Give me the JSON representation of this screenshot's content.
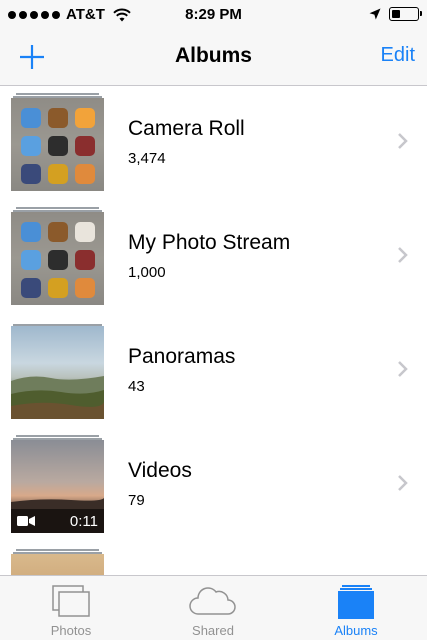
{
  "status_bar": {
    "carrier": "AT&T",
    "time": "8:29 PM",
    "icons": [
      "signal-dots-icon",
      "wifi-icon",
      "location-arrow-icon",
      "battery-icon"
    ]
  },
  "navbar": {
    "add_icon": "plus-icon",
    "title": "Albums",
    "edit_label": "Edit"
  },
  "albums": [
    {
      "name": "Camera Roll",
      "count": "3,474",
      "thumbnail": "home-screen-photo"
    },
    {
      "name": "My Photo Stream",
      "count": "1,000",
      "thumbnail": "home-screen-photo"
    },
    {
      "name": "Panoramas",
      "count": "43",
      "thumbnail": "landscape-panorama"
    },
    {
      "name": "Videos",
      "count": "79",
      "thumbnail": "sunset-video",
      "video_duration": "0:11"
    }
  ],
  "tabbar": {
    "tabs": [
      {
        "label": "Photos",
        "icon": "photos-icon",
        "active": false
      },
      {
        "label": "Shared",
        "icon": "cloud-icon",
        "active": false
      },
      {
        "label": "Albums",
        "icon": "albums-icon",
        "active": true
      }
    ]
  },
  "colors": {
    "accent": "#1a82f7",
    "inactive_tab": "#929292",
    "bar_background": "#f7f7f7"
  }
}
